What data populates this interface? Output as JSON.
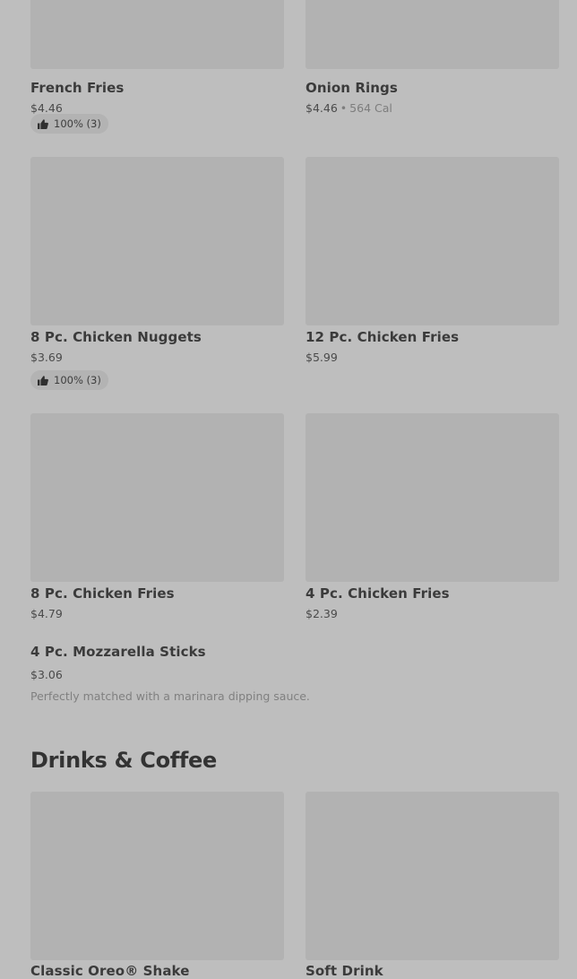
{
  "items": [
    {
      "name": "French Fries",
      "price": "$4.46",
      "rating": "100% (3)"
    },
    {
      "name": "Onion Rings",
      "price": "$4.46",
      "calories": "564 Cal"
    },
    {
      "name": "8 Pc. Chicken Nuggets",
      "price": "$3.69",
      "rating": "100% (3)"
    },
    {
      "name": "12 Pc. Chicken Fries",
      "price": "$5.99"
    },
    {
      "name": "8 Pc. Chicken Fries",
      "price": "$4.79"
    },
    {
      "name": "4 Pc. Chicken Fries",
      "price": "$2.39"
    },
    {
      "name": "4 Pc. Mozzarella Sticks",
      "price": "$3.06",
      "description": "Perfectly matched with a marinara dipping sauce."
    },
    {
      "name": "Classic Oreo® Shake"
    },
    {
      "name": "Soft Drink"
    }
  ],
  "section": {
    "title": "Drinks & Coffee"
  },
  "icons": {
    "rating": "thumbs-up-icon"
  }
}
